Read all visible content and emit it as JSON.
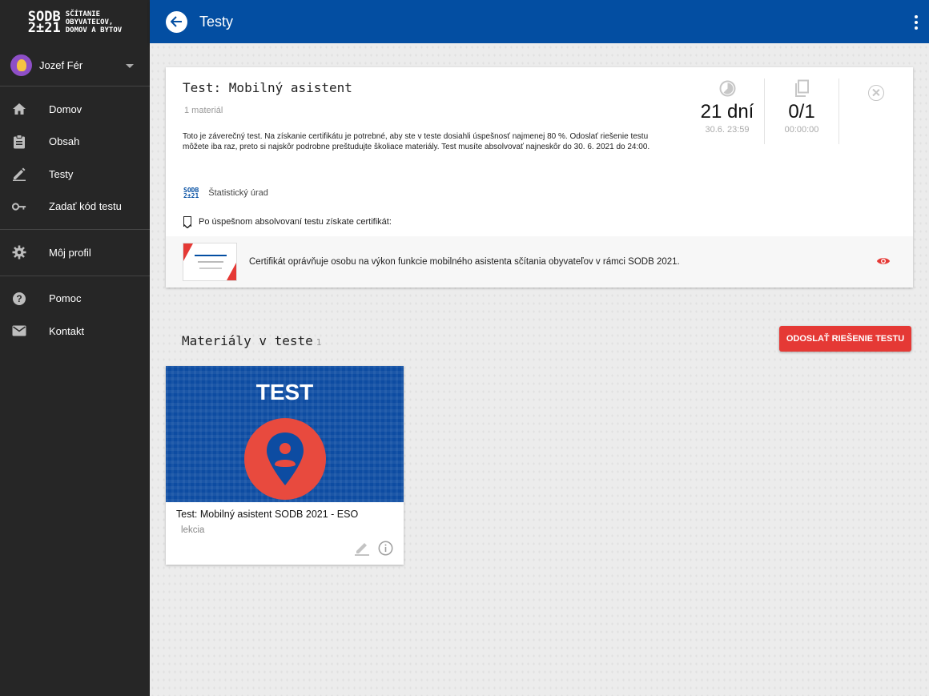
{
  "logo": {
    "mark_top": "SODB",
    "mark_bottom": "2±21",
    "text_1": "SČÍTANIE",
    "text_2": "OBYVATEĽOV,",
    "text_3": "DOMOV A BYTOV"
  },
  "user": {
    "name": "Jozef Fér"
  },
  "nav": {
    "group1": [
      {
        "label": "Domov",
        "icon": "home-icon"
      },
      {
        "label": "Obsah",
        "icon": "clipboard-icon"
      },
      {
        "label": "Testy",
        "icon": "pencil-icon"
      },
      {
        "label": "Zadať kód testu",
        "icon": "key-icon"
      }
    ],
    "group2": [
      {
        "label": "Môj profil",
        "icon": "gear-icon"
      }
    ],
    "group3": [
      {
        "label": "Pomoc",
        "icon": "help-icon"
      },
      {
        "label": "Kontakt",
        "icon": "mail-icon"
      }
    ]
  },
  "topbar": {
    "title": "Testy"
  },
  "test": {
    "title": "Test: Mobilný asistent",
    "material_count": "1 materiál",
    "description": "Toto je záverečný test. Na získanie certifikátu je potrebné, aby ste v teste dosiahli úspešnosť najmenej 80 %. Odoslať riešenie testu môžete iba raz, preto si najskôr podrobne preštudujte školiace materiály. Test musíte absolvovať najneskôr do 30. 6. 2021 do 24:00.",
    "org_logo_top": "SODB",
    "org_logo_bottom": "2±21",
    "org_name": "Štatistický úrad",
    "certificate_label": "Po úspešnom absolvovaní testu získate certifikát:",
    "certificate_text": "Certifikát oprávňuje osobu na výkon funkcie mobilného asistenta sčítania obyvateľov v rámci SODB 2021.",
    "stats": {
      "days_left": "21 dní",
      "deadline": "30.6. 23:59",
      "attempts": "0/1",
      "time": "00:00:00"
    }
  },
  "materials": {
    "heading": "Materiály v teste",
    "count": "1",
    "submit_label": "ODOSLAŤ RIEŠENIE TESTU",
    "items": [
      {
        "image_label": "TEST",
        "title": "Test: Mobilný asistent SODB 2021 - ESO",
        "type": "lekcia"
      }
    ]
  },
  "colors": {
    "primary": "#034ea2",
    "accent": "#e53935",
    "sidebar": "#262626"
  }
}
